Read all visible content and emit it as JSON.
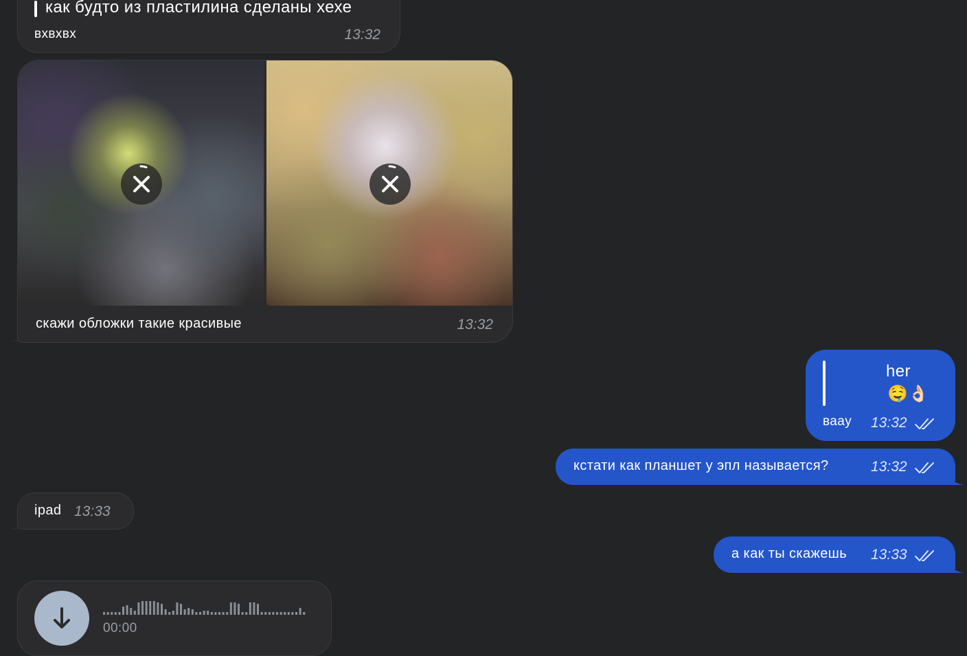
{
  "messages": {
    "m1": {
      "quote": "как будто из пластилина сделаны хехе",
      "text": "вхвхвх",
      "time": "13:32"
    },
    "m2": {
      "caption": "скажи обложки такие красивые",
      "time": "13:32"
    },
    "m3": {
      "quote_author": "her",
      "quote_emoji": "🤤👌🏻",
      "text": "вааy",
      "time": "13:32"
    },
    "m4": {
      "text": "кстати как планшет у эпл называется?",
      "time": "13:32"
    },
    "m5": {
      "text": "ipad",
      "time": "13:33"
    },
    "m6": {
      "text": "а как ты скажешь",
      "time": "13:33"
    },
    "m7": {
      "duration": "00:00"
    }
  },
  "icons": {
    "media_cancel": "close-icon",
    "read_receipt": "double-check-icon",
    "voice_download": "download-arrow-icon"
  },
  "colors": {
    "background": "#222426",
    "incoming_bubble": "#2b2b2d",
    "outgoing_bubble": "#2455c9",
    "time_incoming": "#9a9da3"
  }
}
